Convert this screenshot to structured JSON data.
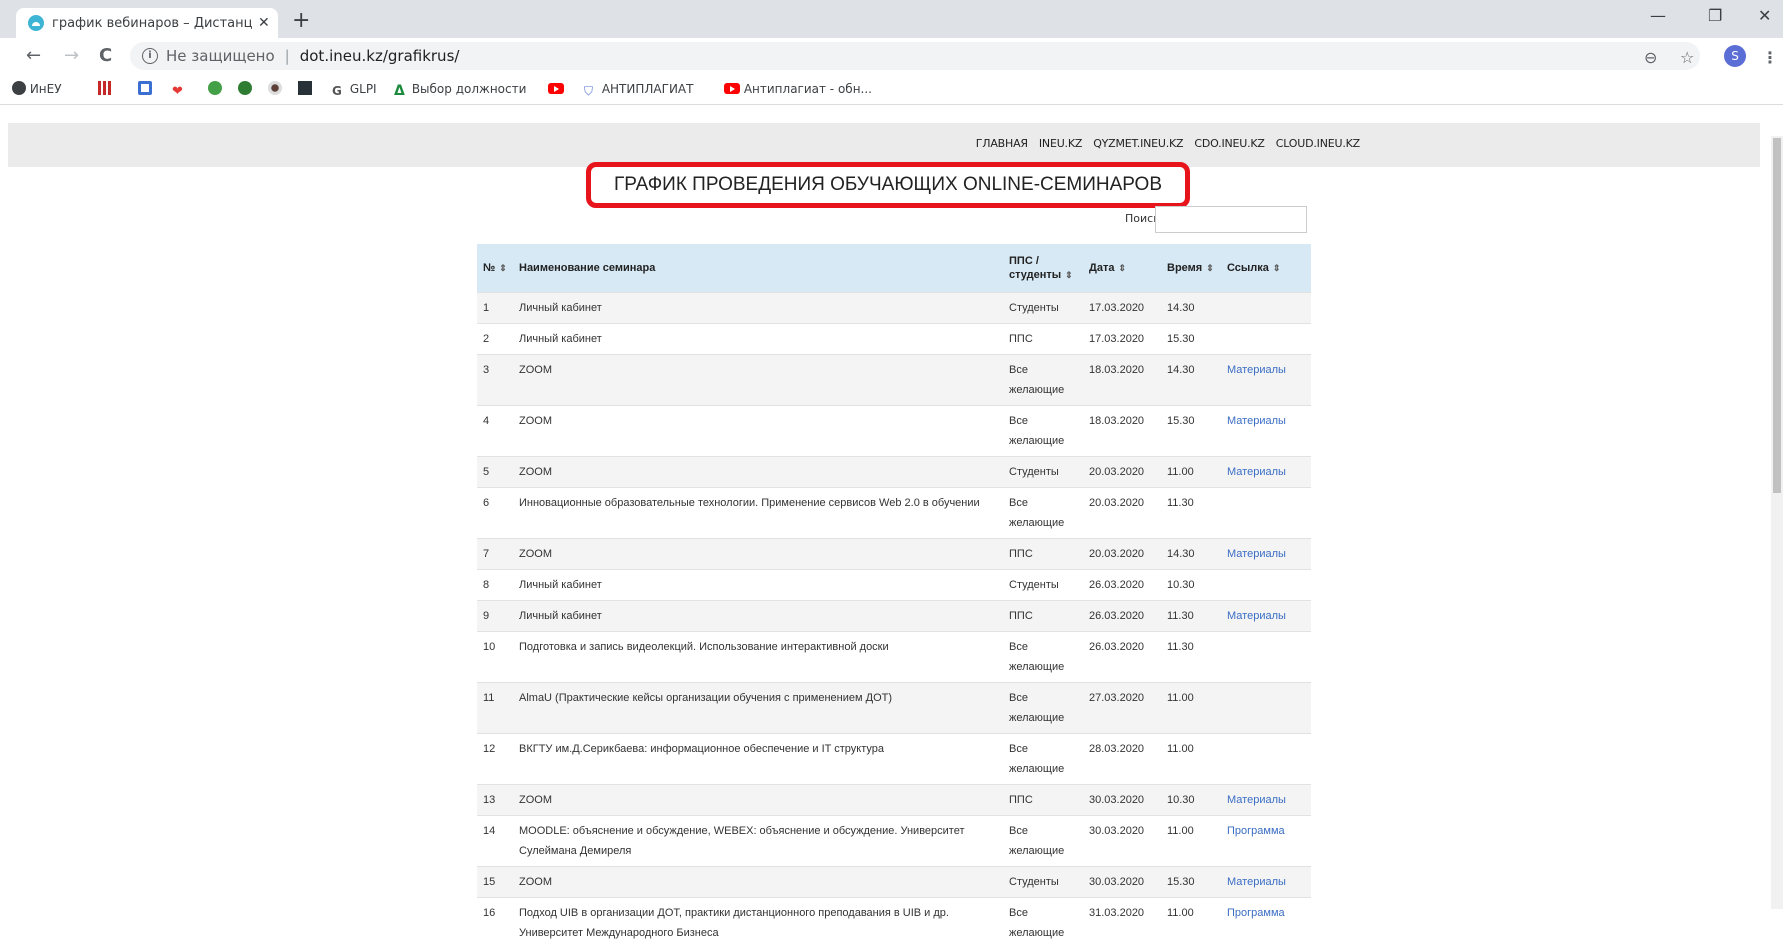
{
  "browser": {
    "tab_title": "график вебинаров – Дистанцио",
    "tab_close": "✕",
    "new_tab": "+",
    "window_controls": [
      "—",
      "❐",
      "✕"
    ],
    "nav": {
      "back": "←",
      "forward": "→",
      "reload": "C"
    },
    "security_label": "Не защищено",
    "url": "dot.ineu.kz/grafikrus/",
    "profile_initial": "S",
    "bookmarks": [
      {
        "label": "ИнЕУ",
        "icon": "globe-icon"
      },
      {
        "label": "",
        "icon": "bars-icon"
      },
      {
        "label": "",
        "icon": "target-icon"
      },
      {
        "label": "",
        "icon": "heart-icon"
      },
      {
        "label": "",
        "icon": "green-leaf-icon"
      },
      {
        "label": "",
        "icon": "green-2-icon"
      },
      {
        "label": "",
        "icon": "eye-icon"
      },
      {
        "label": "",
        "icon": "n-logo-icon"
      },
      {
        "label": "GLPI",
        "icon": "g-icon"
      },
      {
        "label": "Выбор должности",
        "icon": "delta-icon"
      },
      {
        "label": "",
        "icon": "youtube-icon"
      },
      {
        "label": "АНТИПЛАГИАТ",
        "icon": "shield-icon"
      },
      {
        "label": "Антиплагиат - обн...",
        "icon": "youtube-icon"
      }
    ]
  },
  "site_nav": [
    "ГЛАВНАЯ",
    "INEU.KZ",
    "QYZMET.INEU.KZ",
    "CDO.INEU.KZ",
    "CLOUD.INEU.KZ"
  ],
  "page": {
    "title": "ГРАФИК ПРОВЕДЕНИЯ ОБУЧАЮЩИХ ONLINE-СЕМИНАРОВ",
    "search_label": "Поиск:",
    "search_value": ""
  },
  "table": {
    "headers": [
      "№",
      "Наименование семинара",
      "ППС / студенты",
      "Дата",
      "Время",
      "Ссылка"
    ],
    "rows": [
      {
        "n": "1",
        "name": "Личный кабинет",
        "who": "Студенты",
        "date": "17.03.2020",
        "time": "14.30",
        "link": ""
      },
      {
        "n": "2",
        "name": "Личный кабинет",
        "who": "ППС",
        "date": "17.03.2020",
        "time": "15.30",
        "link": ""
      },
      {
        "n": "3",
        "name": "ZOOM",
        "who": "Все желающие",
        "date": "18.03.2020",
        "time": "14.30",
        "link": "Материалы"
      },
      {
        "n": "4",
        "name": "ZOOM",
        "who": "Все желающие",
        "date": "18.03.2020",
        "time": "15.30",
        "link": "Материалы"
      },
      {
        "n": "5",
        "name": "ZOOM",
        "who": "Студенты",
        "date": "20.03.2020",
        "time": "11.00",
        "link": "Материалы"
      },
      {
        "n": "6",
        "name": "Инновационные образовательные технологии. Применение сервисов Web 2.0 в обучении",
        "who": "Все желающие",
        "date": "20.03.2020",
        "time": "11.30",
        "link": ""
      },
      {
        "n": "7",
        "name": "ZOOM",
        "who": "ППС",
        "date": "20.03.2020",
        "time": "14.30",
        "link": "Материалы"
      },
      {
        "n": "8",
        "name": "Личный кабинет",
        "who": "Студенты",
        "date": "26.03.2020",
        "time": "10.30",
        "link": ""
      },
      {
        "n": "9",
        "name": "Личный кабинет",
        "who": "ППС",
        "date": "26.03.2020",
        "time": "11.30",
        "link": "Материалы"
      },
      {
        "n": "10",
        "name": "Подготовка и запись видеолекций. Использование интерактивной доски",
        "who": "Все желающие",
        "date": "26.03.2020",
        "time": "11.30",
        "link": ""
      },
      {
        "n": "11",
        "name": "AlmaU (Практические кейсы организации обучения с применением ДОТ)",
        "who": "Все желающие",
        "date": "27.03.2020",
        "time": "11.00",
        "link": ""
      },
      {
        "n": "12",
        "name": "ВКГТУ им.Д.Серикбаева: информационное обеспечение и IT структура",
        "who": "Все желающие",
        "date": "28.03.2020",
        "time": "11.00",
        "link": ""
      },
      {
        "n": "13",
        "name": "ZOOM",
        "who": "ППС",
        "date": "30.03.2020",
        "time": "10.30",
        "link": "Материалы"
      },
      {
        "n": "14",
        "name": "MOODLE: объяснение и обсуждение, WEBEX: объяснение и обсуждение. Университет Сулеймана Демиреля",
        "who": "Все желающие",
        "date": "30.03.2020",
        "time": "11.00",
        "link": "Программа"
      },
      {
        "n": "15",
        "name": "ZOOM",
        "who": "Студенты",
        "date": "30.03.2020",
        "time": "15.30",
        "link": "Материалы"
      },
      {
        "n": "16",
        "name": "Подход UIB в организации ДОТ, практики дистанционного преподавания в UIB и др. Университет Международного Бизнеса",
        "who": "Все желающие",
        "date": "31.03.2020",
        "time": "11.00",
        "link": "Программа"
      }
    ]
  }
}
